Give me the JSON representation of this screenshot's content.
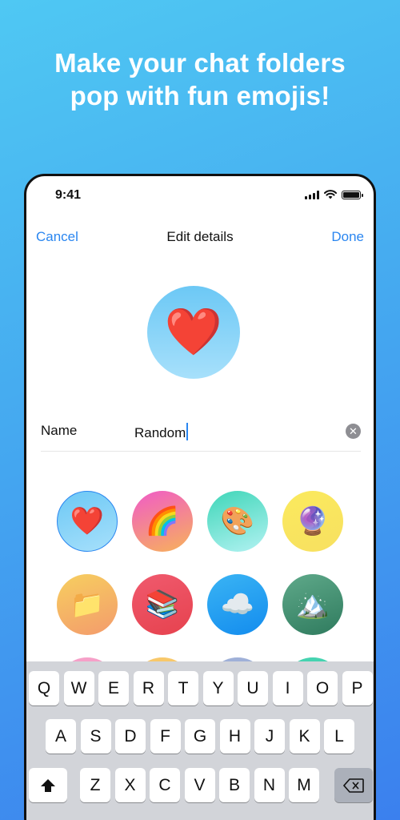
{
  "promo": {
    "line1": "Make your chat folders",
    "line2": "pop with fun emojis!"
  },
  "status_bar": {
    "time": "9:41",
    "icons": [
      "signal-icon",
      "wifi-icon",
      "battery-icon"
    ]
  },
  "nav": {
    "cancel_label": "Cancel",
    "title": "Edit details",
    "done_label": "Done"
  },
  "folder": {
    "emoji": "❤️"
  },
  "name_field": {
    "label": "Name",
    "value": "Random",
    "clear_icon": "clear-icon"
  },
  "emoji_options": [
    {
      "name": "heart",
      "emoji": "❤️",
      "selected": true,
      "colors": [
        "#6cc8f5",
        "#a7e0fb"
      ]
    },
    {
      "name": "rainbow",
      "emoji": "🌈",
      "selected": false,
      "colors": [
        "#f05bc8",
        "#f7b25a"
      ]
    },
    {
      "name": "palette",
      "emoji": "🎨",
      "selected": false,
      "colors": [
        "#3fd6b8",
        "#b2f2f2"
      ]
    },
    {
      "name": "crystal-ball",
      "emoji": "🔮",
      "selected": false,
      "colors": [
        "#fbea5e",
        "#f7e060"
      ]
    },
    {
      "name": "folder",
      "emoji": "📁",
      "selected": false,
      "colors": [
        "#f7cf5f",
        "#f39b6c"
      ]
    },
    {
      "name": "books",
      "emoji": "📚",
      "selected": false,
      "colors": [
        "#f05a6e",
        "#e6424e"
      ]
    },
    {
      "name": "cloud",
      "emoji": "☁️",
      "selected": false,
      "colors": [
        "#3ab4f4",
        "#138cee"
      ]
    },
    {
      "name": "mountain",
      "emoji": "🏔️",
      "selected": false,
      "colors": [
        "#5fa98a",
        "#2f7b5e"
      ]
    }
  ],
  "keyboard": {
    "row1": [
      "Q",
      "W",
      "E",
      "R",
      "T",
      "Y",
      "U",
      "I",
      "O",
      "P"
    ],
    "row2": [
      "A",
      "S",
      "D",
      "F",
      "G",
      "H",
      "J",
      "K",
      "L"
    ],
    "row3": [
      "Z",
      "X",
      "C",
      "V",
      "B",
      "N",
      "M"
    ],
    "shift_icon": "shift-icon",
    "delete_icon": "backspace-icon"
  },
  "colors": {
    "accent": "#2a86f0"
  }
}
